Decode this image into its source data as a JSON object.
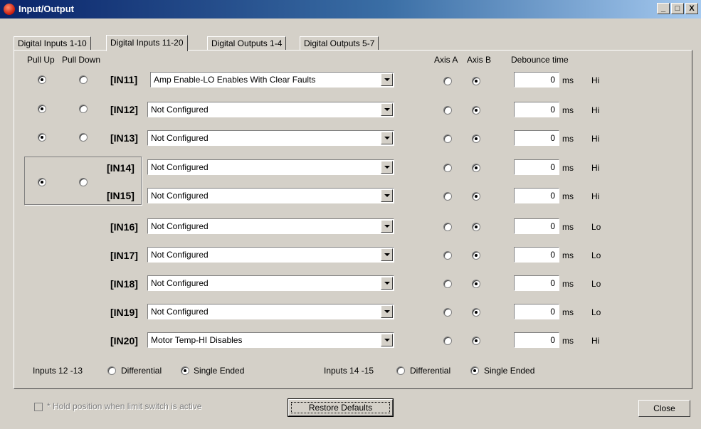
{
  "window": {
    "title": "Input/Output",
    "min_label": "_",
    "max_label": "□",
    "close_label": "X"
  },
  "tabs": [
    {
      "label": "Digital Inputs 1-10"
    },
    {
      "label": "Digital Inputs 11-20"
    },
    {
      "label": "Digital Outputs 1-4"
    },
    {
      "label": "Digital Outputs 5-7"
    }
  ],
  "headers": {
    "pull_up": "Pull Up",
    "pull_down": "Pull Down",
    "axis_a": "Axis A",
    "axis_b": "Axis B",
    "debounce": "Debounce time"
  },
  "rows": [
    {
      "label": "[IN11]",
      "function": "Amp Enable-LO Enables With Clear Faults",
      "debounce": "0",
      "unit": "ms",
      "level": "Hi"
    },
    {
      "label": "[IN12]",
      "function": "Not Configured",
      "debounce": "0",
      "unit": "ms",
      "level": "Hi"
    },
    {
      "label": "[IN13]",
      "function": "Not Configured",
      "debounce": "0",
      "unit": "ms",
      "level": "Hi"
    },
    {
      "label": "[IN14]",
      "function": "Not Configured",
      "debounce": "0",
      "unit": "ms",
      "level": "Hi"
    },
    {
      "label": "[IN15]",
      "function": "Not Configured",
      "debounce": "0",
      "unit": "ms",
      "level": "Hi"
    },
    {
      "label": "[IN16]",
      "function": "Not Configured",
      "debounce": "0",
      "unit": "ms",
      "level": "Lo"
    },
    {
      "label": "[IN17]",
      "function": "Not Configured",
      "debounce": "0",
      "unit": "ms",
      "level": "Lo"
    },
    {
      "label": "[IN18]",
      "function": "Not Configured",
      "debounce": "0",
      "unit": "ms",
      "level": "Lo"
    },
    {
      "label": "[IN19]",
      "function": "Not Configured",
      "debounce": "0",
      "unit": "ms",
      "level": "Lo"
    },
    {
      "label": "[IN20]",
      "function": "Motor Temp-HI Disables",
      "debounce": "0",
      "unit": "ms",
      "level": "Hi"
    }
  ],
  "pairs": [
    {
      "label": "Inputs 12 -13",
      "differential": "Differential",
      "single_ended": "Single Ended"
    },
    {
      "label": "Inputs 14 -15",
      "differential": "Differential",
      "single_ended": "Single Ended"
    }
  ],
  "footer": {
    "hold_label": "* Hold position when limit switch is active",
    "restore_label": "Restore Defaults",
    "close_label": "Close"
  }
}
